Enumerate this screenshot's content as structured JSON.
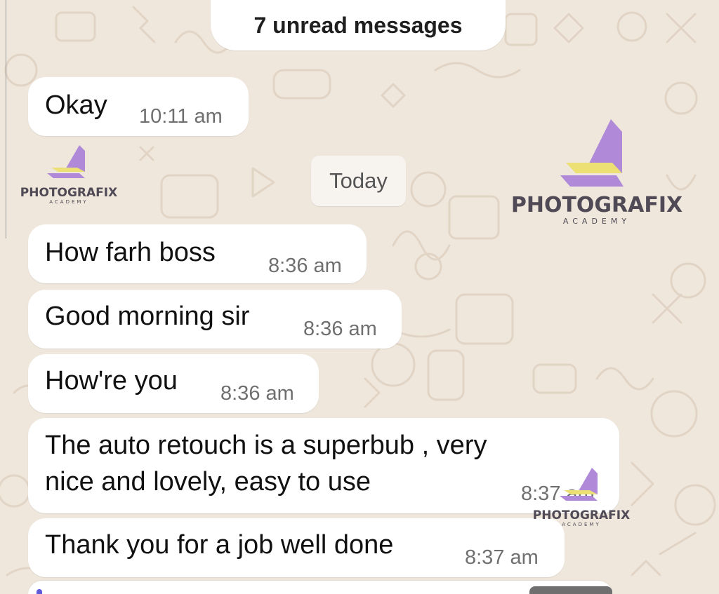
{
  "banner": {
    "unread_label": "7 unread messages"
  },
  "previous_message": {
    "text": "Okay",
    "time": "10:11 am"
  },
  "date_separator": {
    "label": "Today"
  },
  "messages": [
    {
      "text": "How farh boss",
      "time": "8:36 am"
    },
    {
      "text": "Good morning sir",
      "time": "8:36 am"
    },
    {
      "text": "How're you",
      "time": "8:36 am"
    },
    {
      "lines": [
        "The auto retouch is a superbub , very",
        "nice and lovely, easy to use"
      ],
      "time": "8:37 am"
    },
    {
      "text": "Thank you for a job well done",
      "time": "8:37 am"
    }
  ],
  "watermarks": {
    "top_left": {
      "name": "PHOTOGRAFIX",
      "sub": "ACADEMY"
    },
    "top_right": {
      "name": "PHOTOGRAFIX",
      "sub": "ACADEMY"
    },
    "bottom": {
      "name": "PHOTOGRAFIX",
      "sub": "ACADEMY"
    }
  },
  "colors": {
    "wallpaper": "#efe7dc",
    "bubble": "#ffffff",
    "text": "#111111",
    "timestamp": "#6f6f6f",
    "logo_purple": "#b08ad8",
    "logo_yellow": "#ecdf73",
    "quoted_card_accent": "#5e5ad8"
  },
  "icons": [
    "doodle-pattern-icon",
    "logo-book-icon"
  ]
}
